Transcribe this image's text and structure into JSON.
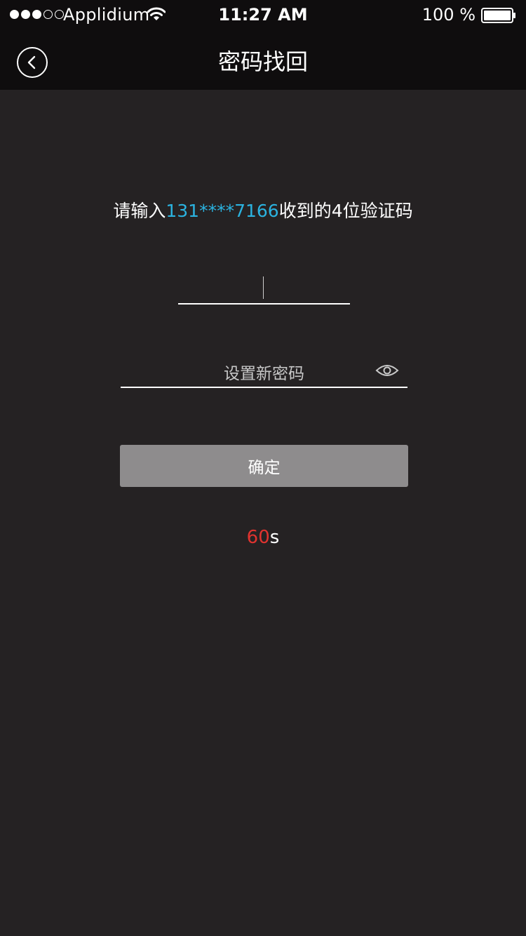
{
  "status_bar": {
    "carrier": "Applidium",
    "time": "11:27 AM",
    "battery": "100 %"
  },
  "nav": {
    "title": "密码找回",
    "back_icon": "chevron-left-icon"
  },
  "instruction": {
    "prefix": "请输入",
    "phone": "131****7166",
    "suffix": "收到的4位验证码",
    "phone_color": "#2bb3e0"
  },
  "code_input": {
    "value": ""
  },
  "password_input": {
    "placeholder": "设置新密码",
    "toggle_icon": "eye-icon"
  },
  "confirm_button": {
    "label": "确定"
  },
  "countdown": {
    "value": "60",
    "unit": "s",
    "value_color": "#e0332f"
  },
  "colors": {
    "background": "#252223",
    "nav_background": "#0f0d0e",
    "button": "#8e8c8d"
  }
}
